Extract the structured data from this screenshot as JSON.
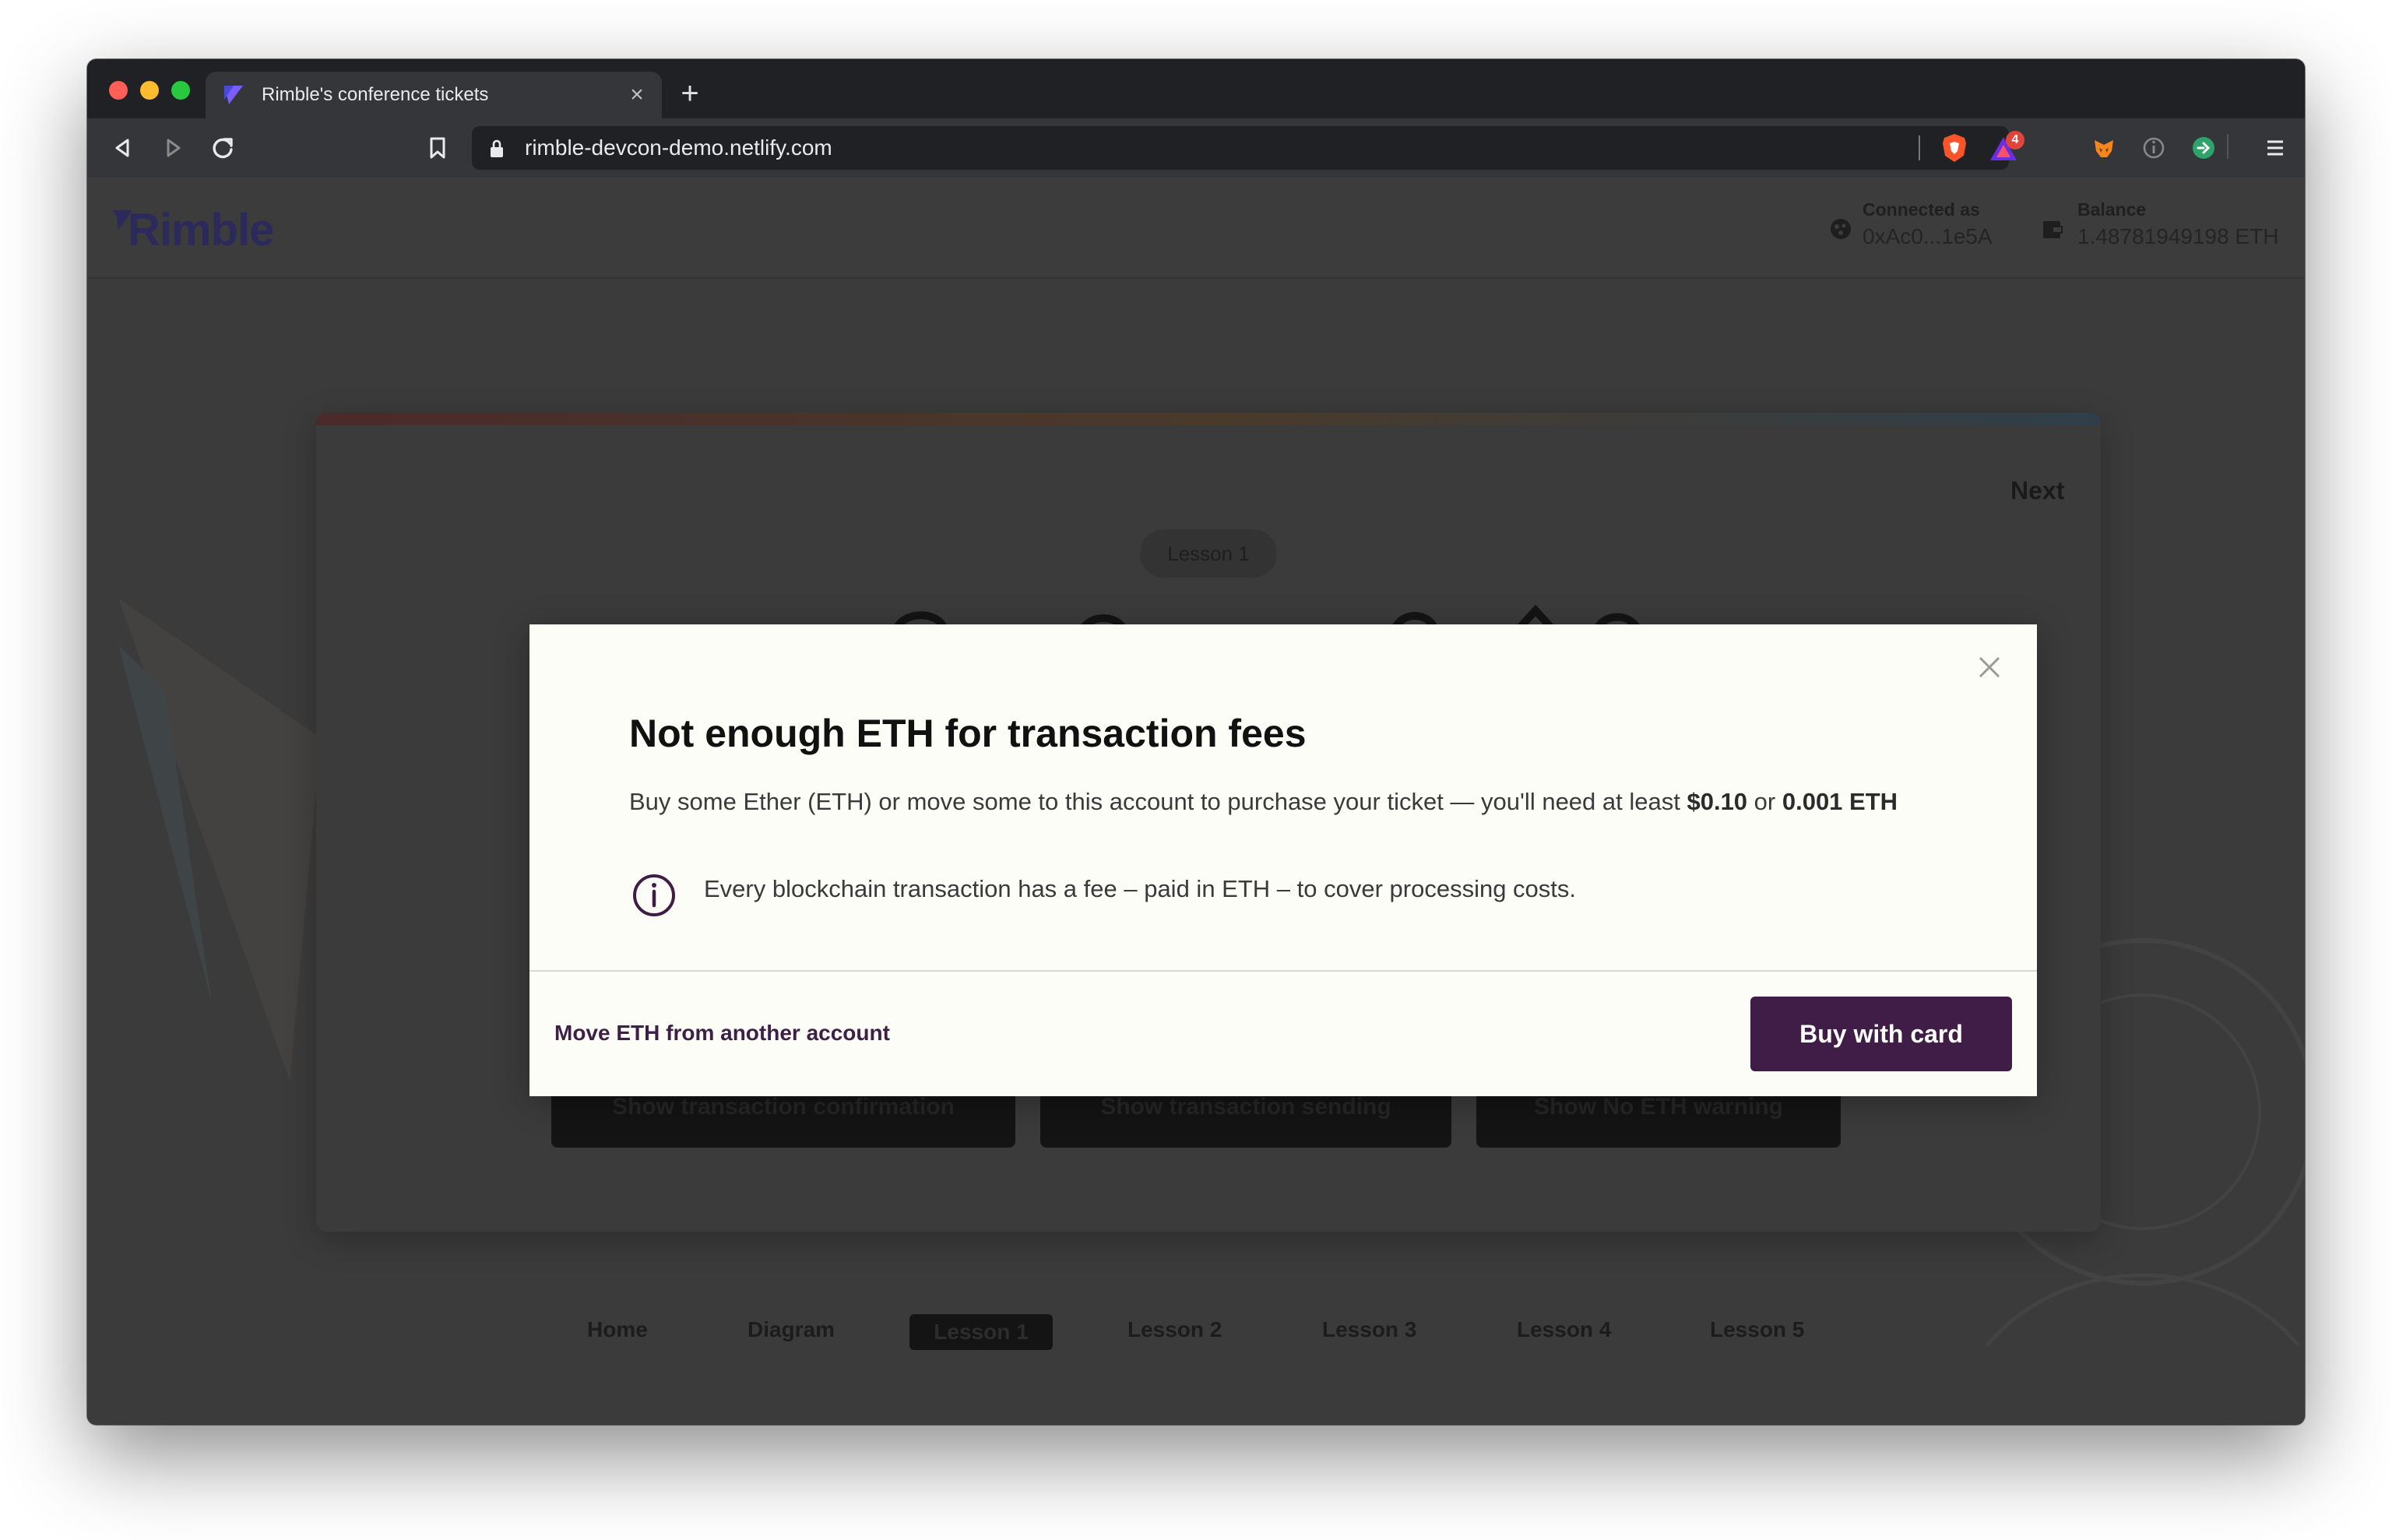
{
  "browser": {
    "tab_title": "Rimble's conference tickets",
    "url": "rimble-devcon-demo.netlify.com",
    "extension_badge": "4"
  },
  "header": {
    "logo": "Rimble",
    "connected_label": "Connected as",
    "connected_value": "0xAc0...1e5A",
    "balance_label": "Balance",
    "balance_value": "1.48781949198 ETH"
  },
  "card": {
    "next_label": "Next",
    "lesson_pill": "Lesson 1",
    "buttons": [
      "Show transaction confirmation",
      "Show transaction sending",
      "Show No ETH warning"
    ]
  },
  "nav": {
    "items": [
      "Home",
      "Diagram",
      "Lesson 1",
      "Lesson 2",
      "Lesson 3",
      "Lesson 4",
      "Lesson 5"
    ],
    "active_index": 2
  },
  "modal": {
    "title": "Not enough ETH for transaction fees",
    "body_prefix": "Buy some Ether (ETH) or move some to this account to purchase your ticket — you'll need at least ",
    "amount_usd": "$0.10",
    "body_or": " or ",
    "amount_eth": "0.001 ETH",
    "info_text": "Every blockchain transaction has a fee – paid in ETH – to cover processing costs.",
    "secondary_action": "Move ETH from another account",
    "primary_action": "Buy with card"
  },
  "colors": {
    "modal_primary": "#3f1d46",
    "overlay_bg": "#3b3b3b",
    "modal_bg": "#fdfdf7"
  }
}
